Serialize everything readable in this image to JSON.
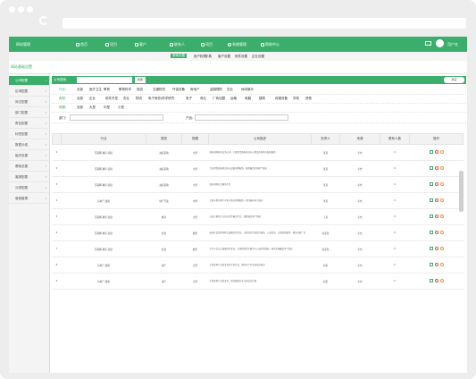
{
  "window": {
    "dots": 3
  },
  "header": {
    "system_name": "网站管理",
    "nav": [
      {
        "label": "首页",
        "icon": "home-icon"
      },
      {
        "label": "项目",
        "icon": "project-icon"
      },
      {
        "label": "客户",
        "icon": "customer-icon"
      },
      {
        "label": "联系人",
        "icon": "contact-icon"
      },
      {
        "label": "项目",
        "icon": "folder-icon"
      },
      {
        "label": "系统管理",
        "icon": "gear-icon",
        "active": true
      },
      {
        "label": "帮助中心",
        "icon": "help-icon"
      }
    ],
    "user_name": "用户名"
  },
  "subnav": [
    {
      "label": "基础设置",
      "active": true
    },
    {
      "label": "用户权限"
    },
    {
      "label": "字典"
    },
    {
      "label": "客户设置"
    },
    {
      "label": "软件设置"
    },
    {
      "label": "企业设置"
    }
  ],
  "breadcrumb": "网站基础设置",
  "sidebar": [
    {
      "label": "公司配置",
      "active": true
    },
    {
      "label": "区域配置"
    },
    {
      "label": "岗位配置"
    },
    {
      "label": "部门配置"
    },
    {
      "label": "角色配置"
    },
    {
      "label": "标签配置"
    },
    {
      "label": "数据分组"
    },
    {
      "label": "组织设置"
    },
    {
      "label": "基础设置"
    },
    {
      "label": "客服配置"
    },
    {
      "label": "分类配置"
    },
    {
      "label": "营销管理"
    }
  ],
  "search": {
    "label": "公司搜索：",
    "button": "搜索",
    "reset": "清空"
  },
  "filters": [
    {
      "label": "行业：",
      "options": [
        "全部",
        "医疗卫生",
        "教育",
        "教育科学",
        "旅游",
        "交通物流",
        "环保设备",
        "房地产",
        "金融理财",
        "农业",
        "休闲娱乐"
      ]
    },
    {
      "label": "类型：",
      "options": [
        "全部",
        "企业",
        "软件开发",
        "农业",
        "物流",
        "电子商务/科学研究",
        "电子",
        "商业",
        "厂商加盟",
        "运输",
        "电器",
        "建筑",
        "传媒设备",
        "学校",
        "其他"
      ]
    },
    {
      "label": "规模：",
      "options": [
        "全部",
        "大型",
        "中型",
        "小型"
      ]
    }
  ],
  "filter_row4": {
    "label1": "部门：",
    "label2": "产品："
  },
  "table": {
    "headers": [
      "",
      "行业",
      "类别",
      "规模",
      "公司描述",
      "负责人",
      "来源",
      "联系人数",
      "操作"
    ],
    "rows": [
      {
        "num": "1",
        "industry": "互联网-教育-家居",
        "category": "政府采购",
        "scale": "大型",
        "desc": "政府采购相关业务公司，主要负责政府机关办公用品的采购与配送服务",
        "owner": "张某",
        "source": "平台",
        "count": "0"
      },
      {
        "num": "2",
        "industry": "互联网-教育-家居",
        "category": "政府采购",
        "scale": "大型",
        "desc": "专业提供政府机关办公设备采购服务，服务覆盖全国多个省市",
        "owner": "张某",
        "source": "平台",
        "count": "0"
      },
      {
        "num": "3",
        "industry": "互联网-教育-家居",
        "category": "政府采购",
        "scale": "大型",
        "desc": "政府采购综合服务平台",
        "owner": "张某",
        "source": "平台",
        "count": "0"
      },
      {
        "num": "4",
        "industry": "房地产-建筑",
        "category": "地产开发",
        "scale": "中型",
        "desc": "主要从事房地产开发与物业管理服务，项目遍布各大城市",
        "owner": "李某",
        "source": "平台",
        "count": "0"
      },
      {
        "num": "5",
        "industry": "互联网-教育-家居",
        "category": "教育",
        "scale": "大型",
        "desc": "以线上教育为主的综合性教育平台，课程涵盖多个领域",
        "owner": "王某",
        "source": "平台",
        "count": "0"
      },
      {
        "num": "6",
        "industry": "互联网-教育-家居",
        "category": "社会",
        "scale": "微型",
        "desc": "面向社会提供多种公益服务的企业，主要业务包括社区服务、公益活动、志愿者组织等，服务对象广泛",
        "owner": "赵某某",
        "source": "平台",
        "count": "0"
      },
      {
        "num": "7",
        "industry": "互联网-教育-家居",
        "category": "社会",
        "scale": "微型",
        "desc": "专注于社会公益服务的企业，主要提供社区服务与公益活动组织，服务范围覆盖多个城市",
        "owner": "赵某某",
        "source": "平台",
        "count": "0"
      },
      {
        "num": "8",
        "industry": "房地产-建筑",
        "category": "地产",
        "scale": "大型",
        "desc": "主营房地产开发业务的大型企业，拥有多个住宅和商业项目",
        "owner": "刘某",
        "source": "平台",
        "count": "0"
      },
      {
        "num": "9",
        "industry": "房地产-建筑",
        "category": "地产",
        "scale": "大型",
        "desc": "主营房地产开发业务，项目覆盖住宅与商业综合体",
        "owner": "刘某",
        "source": "平台",
        "count": "0"
      }
    ]
  }
}
